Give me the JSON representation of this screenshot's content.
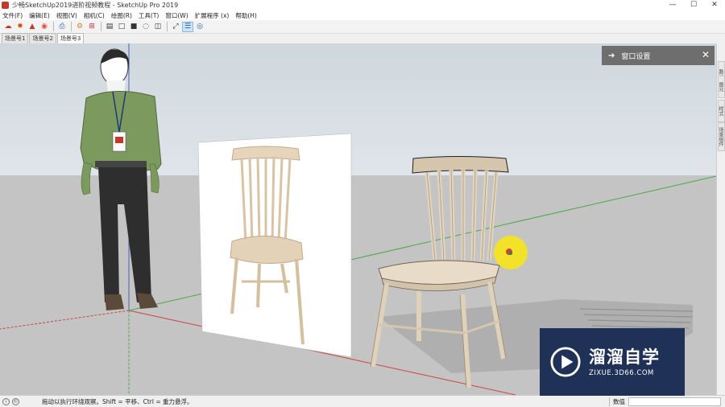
{
  "window": {
    "title": "少畅SketchUp2019进阶视频教程 - SketchUp Pro 2019",
    "controls": {
      "minimize": "—",
      "maximize": "☐",
      "close": "✕"
    }
  },
  "menu": [
    "文件(F)",
    "编辑(E)",
    "视图(V)",
    "相机(C)",
    "绘图(R)",
    "工具(T)",
    "窗口(W)",
    "扩展程序 (x)",
    "帮助(H)"
  ],
  "toolbar": {
    "buttons": [
      {
        "name": "get-models-icon",
        "glyph": "☁"
      },
      {
        "name": "extension-warehouse-icon",
        "glyph": "✹"
      },
      {
        "name": "share-model-icon",
        "glyph": "▲"
      },
      {
        "name": "layout-icon",
        "glyph": "◉"
      },
      {
        "name": "print-icon",
        "glyph": "⎙"
      },
      {
        "name": "settings-gear-icon",
        "glyph": "⚙"
      },
      {
        "name": "components-icon",
        "glyph": "⊞"
      },
      {
        "name": "section-plane-icon",
        "glyph": "▤"
      },
      {
        "name": "monochrome-icon",
        "glyph": "□"
      },
      {
        "name": "shaded-icon",
        "glyph": "■"
      },
      {
        "name": "xray-icon",
        "glyph": "◌"
      },
      {
        "name": "hidden-line-icon",
        "glyph": "◫"
      },
      {
        "name": "orbit-icon",
        "glyph": "⤢"
      },
      {
        "name": "outliner-icon",
        "glyph": "☰"
      },
      {
        "name": "target-icon",
        "glyph": "◎"
      }
    ]
  },
  "scene_tabs": [
    "场景号1",
    "场景号2",
    "场景号3"
  ],
  "panel": {
    "title": "窗口设置",
    "arrow": "➔",
    "close": "✕"
  },
  "tray_tabs": [
    "默认面板",
    "图元",
    "样式",
    "场景组件"
  ],
  "status": {
    "hint": "拖动以执行环绕观察。Shift = 平移、Ctrl = 重力悬浮。",
    "measure_label": "数值",
    "measure_value": ""
  },
  "watermark": {
    "brand": "溜溜自学",
    "url": "ZIXUE.3D66.COM"
  },
  "colors": {
    "sky": "#d6dde3",
    "ground": "#c4c4c4",
    "red_axis": "#d0413f",
    "green_axis": "#4aa84a",
    "blue_axis": "#4a62b8",
    "panel": "#6e6e6e",
    "watermark_bg": "#1f3157",
    "cursor_highlight": "#f5e41c"
  }
}
